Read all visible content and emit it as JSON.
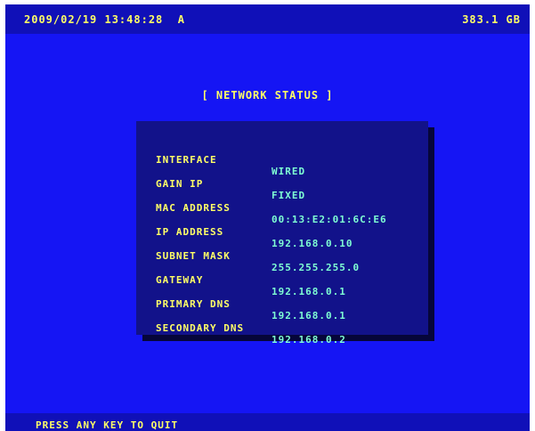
{
  "colors": {
    "screen_bg": "#1515f4",
    "bar_bg": "#1010b8",
    "panel_bg": "#12128a",
    "label_text": "#ffff66",
    "value_text": "#7fffd4"
  },
  "header": {
    "datetime": "2009/02/19 13:48:28  A",
    "disk_free": "383.1 GB"
  },
  "title": "[ NETWORK STATUS ]",
  "network": [
    {
      "label": "INTERFACE",
      "value": "WIRED"
    },
    {
      "label": "GAIN IP",
      "value": "FIXED"
    },
    {
      "label": "MAC ADDRESS",
      "value": "00:13:E2:01:6C:E6"
    },
    {
      "label": "IP ADDRESS",
      "value": "192.168.0.10"
    },
    {
      "label": "SUBNET MASK",
      "value": "255.255.255.0"
    },
    {
      "label": "GATEWAY",
      "value": "192.168.0.1"
    },
    {
      "label": "PRIMARY DNS",
      "value": "192.168.0.1"
    },
    {
      "label": "SECONDARY DNS",
      "value": "192.168.0.2"
    }
  ],
  "footer": {
    "hint": "PRESS ANY KEY TO QUIT"
  }
}
